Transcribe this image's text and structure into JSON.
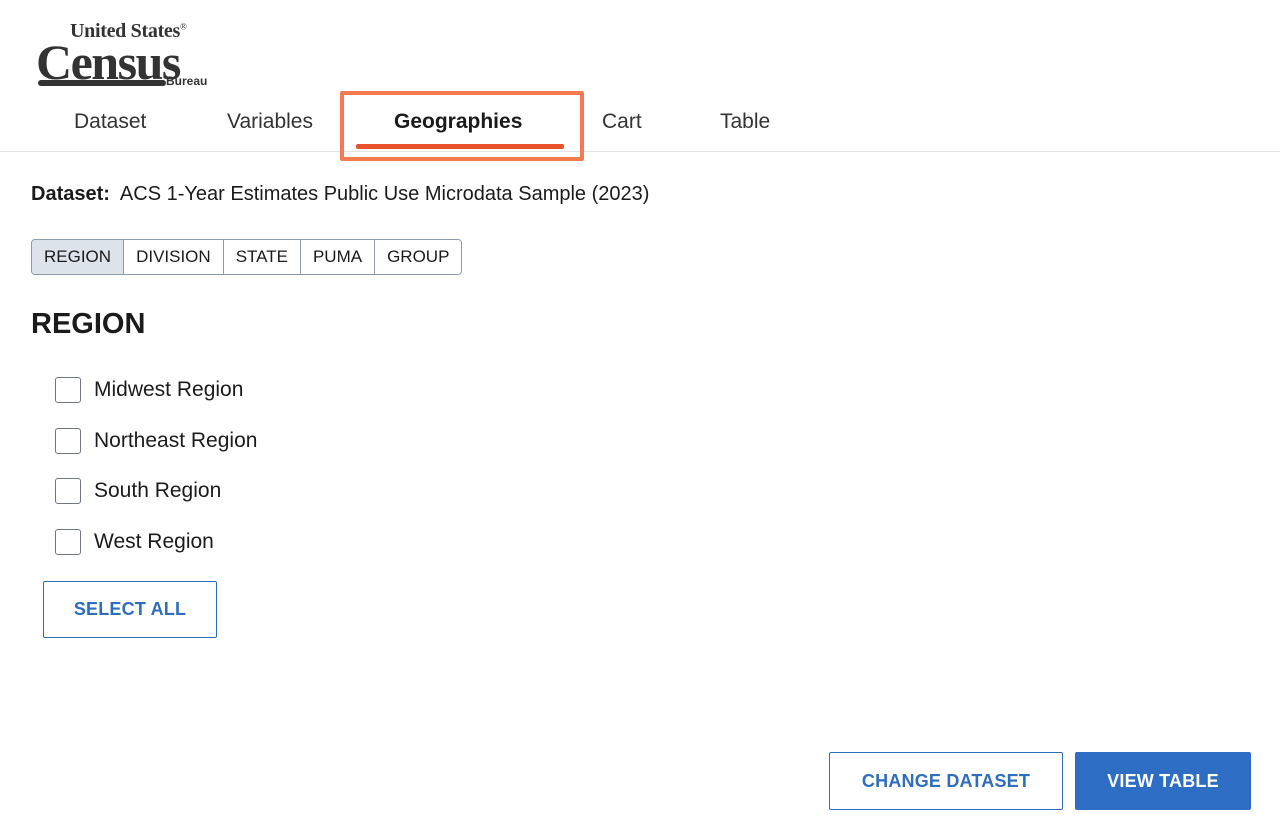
{
  "logo": {
    "line1": "United States",
    "reg": "®",
    "line2": "Census",
    "line3": "Bureau"
  },
  "tabs": [
    {
      "label": "Dataset"
    },
    {
      "label": "Variables"
    },
    {
      "label": "Geographies",
      "active": true
    },
    {
      "label": "Cart"
    },
    {
      "label": "Table"
    }
  ],
  "dataset": {
    "label": "Dataset:",
    "value": "ACS 1-Year Estimates Public Use Microdata Sample (2023)"
  },
  "segments": [
    {
      "label": "REGION",
      "active": true
    },
    {
      "label": "DIVISION"
    },
    {
      "label": "STATE"
    },
    {
      "label": "PUMA"
    },
    {
      "label": "GROUP"
    }
  ],
  "section_title": "REGION",
  "regions": [
    {
      "label": "Midwest Region",
      "checked": false
    },
    {
      "label": "Northeast Region",
      "checked": false
    },
    {
      "label": "South Region",
      "checked": false
    },
    {
      "label": "West Region",
      "checked": false
    }
  ],
  "buttons": {
    "select_all": "SELECT ALL",
    "change_dataset": "CHANGE DATASET",
    "view_table": "VIEW TABLE"
  },
  "colors": {
    "accent": "#2e6dc4",
    "tab_underline": "#e9532c",
    "highlight": "#f47a4f"
  }
}
